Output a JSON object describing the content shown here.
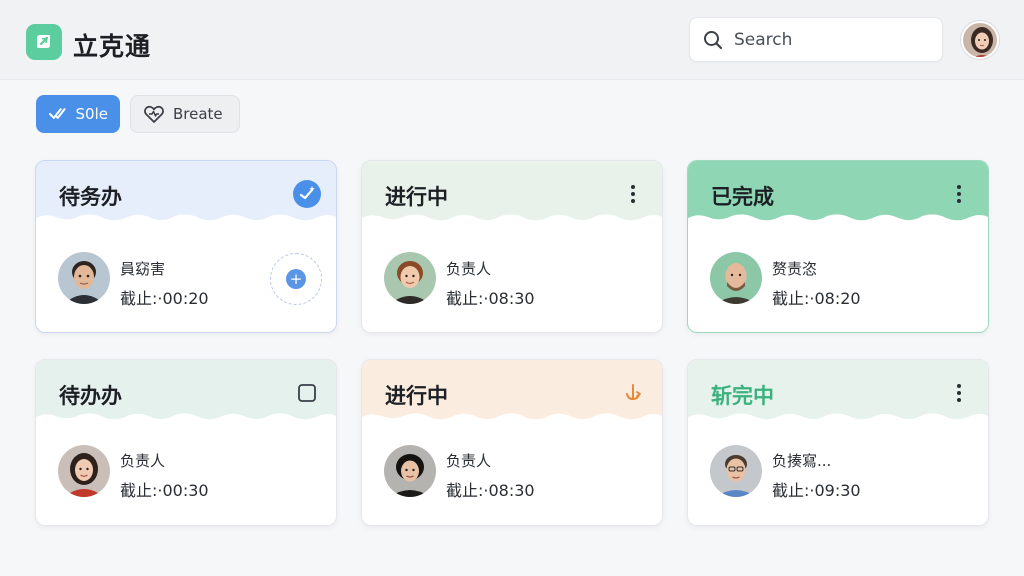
{
  "app": {
    "title": "立克通"
  },
  "search": {
    "placeholder": "Search"
  },
  "toolbar": {
    "sole_label": "S0le",
    "create_label": "Breate"
  },
  "colors": {
    "accent": "#4a90e8",
    "brand": "#5ccd9e",
    "done": "#8fd6b5",
    "warning": "#e58a3a"
  },
  "cards": [
    {
      "title": "待务办",
      "corner_icon": "check-sparkle-icon",
      "assignee_label": "員窈害",
      "due": "截止:·00:20"
    },
    {
      "title": "进行中",
      "corner_icon": "more-vertical-icon",
      "assignee_label": "负责人",
      "due": "截止:·08:30"
    },
    {
      "title": "已完成",
      "corner_icon": "more-vertical-icon",
      "assignee_label": "赘责恣",
      "due": "截止:·08:20"
    },
    {
      "title": "待办办",
      "corner_icon": "checkbox-icon",
      "assignee_label": "负责人",
      "due": "截止:·00:30"
    },
    {
      "title": "进行中",
      "corner_icon": "anchor-arrow-icon",
      "assignee_label": "负责人",
      "due": "截止:·08:30"
    },
    {
      "title": "斩完中",
      "corner_icon": "more-vertical-icon",
      "assignee_label": "负揍寫...",
      "due": "截止:·09:30"
    }
  ]
}
